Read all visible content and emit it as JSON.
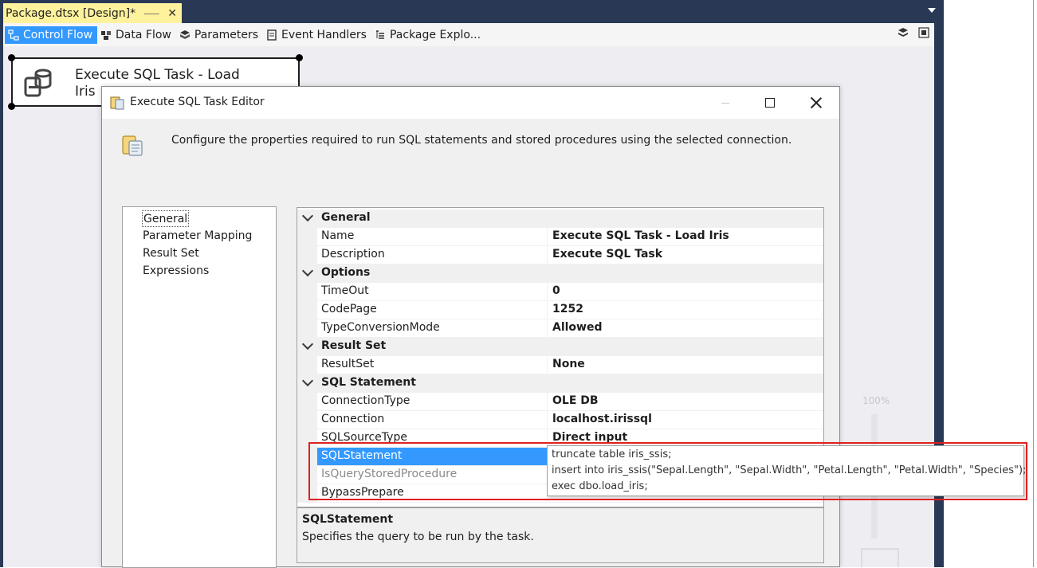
{
  "document_tab": {
    "title": "Package.dtsx [Design]*",
    "pin_icon": "pin-icon",
    "close_icon": "close-icon"
  },
  "designer_tabs": [
    {
      "label": "Control Flow",
      "icon": "control-flow-icon",
      "active": true
    },
    {
      "label": "Data Flow",
      "icon": "data-flow-icon"
    },
    {
      "label": "Parameters",
      "icon": "parameters-icon"
    },
    {
      "label": "Event Handlers",
      "icon": "event-handlers-icon"
    },
    {
      "label": "Package Explo...",
      "icon": "package-explorer-icon"
    }
  ],
  "canvas": {
    "task": {
      "label_line1": "Execute SQL Task - Load",
      "label_line2": "Iris"
    },
    "zoom": "100%"
  },
  "dialog": {
    "title": "Execute SQL Task Editor",
    "description": "Configure the properties required to run SQL statements and stored procedures using the selected connection.",
    "nav": [
      {
        "label": "General",
        "selected": true
      },
      {
        "label": "Parameter Mapping"
      },
      {
        "label": "Result Set"
      },
      {
        "label": "Expressions"
      }
    ],
    "grid": {
      "categories": {
        "general": "General",
        "options": "Options",
        "result_set": "Result Set",
        "sql_statement": "SQL Statement"
      },
      "rows": {
        "name": {
          "label": "Name",
          "value": "Execute SQL Task - Load Iris"
        },
        "description": {
          "label": "Description",
          "value": "Execute SQL Task"
        },
        "timeout": {
          "label": "TimeOut",
          "value": "0"
        },
        "codepage": {
          "label": "CodePage",
          "value": "1252"
        },
        "typeconv": {
          "label": "TypeConversionMode",
          "value": "Allowed"
        },
        "resultset": {
          "label": "ResultSet",
          "value": "None"
        },
        "conntype": {
          "label": "ConnectionType",
          "value": "OLE DB"
        },
        "connection": {
          "label": "Connection",
          "value": "localhost.irissql"
        },
        "sqlsource": {
          "label": "SQLSourceType",
          "value": "Direct input"
        },
        "sqlstatement": {
          "label": "SQLStatement",
          "value": ""
        },
        "isquery": {
          "label": "IsQueryStoredProcedure",
          "value": ""
        },
        "bypass": {
          "label": "BypassPrepare",
          "value": ""
        }
      }
    },
    "sql_dropdown": [
      "truncate table iris_ssis;",
      "insert into iris_ssis(\"Sepal.Length\", \"Sepal.Width\", \"Petal.Length\", \"Petal.Width\", \"Species\");",
      "exec dbo.load_iris;"
    ],
    "help": {
      "title": "SQLStatement",
      "text": "Specifies the query to be run by the task."
    }
  },
  "colors": {
    "accent": "#3399ff",
    "tab_highlight": "#fff29d",
    "frame": "#293955",
    "callout": "#e02020"
  }
}
